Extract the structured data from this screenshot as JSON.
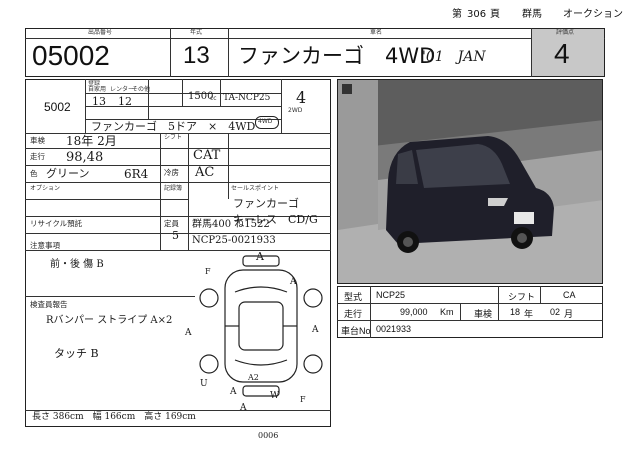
{
  "header": {
    "page_prefix": "第",
    "page_number": "306",
    "page_suffix": "頁",
    "region": "群馬",
    "auction": "オークション",
    "lot_label": "出品番号",
    "year_label": "年式",
    "model_label": "車名",
    "grade_label": "評価点",
    "lot_number": "05002",
    "year": "13",
    "model_name": "ファンカーゴ　4WD",
    "model_note": "'01　JAN",
    "grade": "4"
  },
  "form": {
    "lot_small": "5002",
    "reg_labels": [
      "登録",
      "自家用",
      "レンター",
      "その他"
    ],
    "reg_year": "13",
    "reg_month": "12",
    "displacement": "1500",
    "displacement_unit": "cc",
    "model_code": "TA-NCP25",
    "grade_circle": "4",
    "car_name_hand": "ファンカーゴ　5ドア　×　4WD",
    "drive_options": [
      "2WD",
      "4WD"
    ],
    "inspection_label": "車検",
    "inspection_value": "18年 2月",
    "mileage_label": "走行",
    "mileage_value": "98,48",
    "shift_label": "シフト",
    "shift_value": "CAT",
    "color_label": "色",
    "color_value": "グリーン",
    "color_code": "6R4",
    "ac_label": "冷房",
    "ac_value": "AC",
    "option_label": "オプション",
    "sales_point_label": "セールスポイント",
    "sales_point_lines": [
      "ファンカーゴ",
      "キーレス　CD/G"
    ],
    "capacity_label": "定員",
    "capacity_value": "5",
    "record_label": "記録簿",
    "recycle_label": "リサイクル預託",
    "plate_value": "群馬400 ね1522",
    "serial_value": "NCP25-0021933",
    "notes_label": "注意事項",
    "notes_hand": "前・後 傷 B",
    "inspector_label": "検査員報告",
    "inspector_lines": [
      "Rバンパー ストライプ A×2",
      "タッチ B"
    ],
    "dims": "長さ 386cm　幅 166cm　高さ 169cm",
    "diagram_marks": [
      "A",
      "A",
      "A",
      "A",
      "A",
      "A",
      "U",
      "W",
      "A2",
      "F",
      "F"
    ],
    "bottom_code": "0006"
  },
  "specs": {
    "type_label": "型式",
    "type_value": "NCP25",
    "shift_label": "シフト",
    "shift_value": "CA",
    "mileage_label": "走行",
    "mileage_value": "99,000",
    "mileage_unit": "Km",
    "inspect_label": "車検",
    "inspect_year": "18",
    "inspect_year_unit": "年",
    "inspect_month": "02",
    "inspect_month_unit": "月",
    "chassis_label": "車台No",
    "chassis_value": "0021933"
  }
}
